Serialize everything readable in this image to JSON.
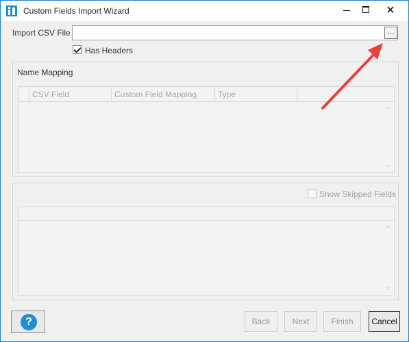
{
  "window": {
    "title": "Custom Fields Import Wizard",
    "controls": {
      "minimize": "—",
      "maximize": "☐",
      "close": "✕"
    }
  },
  "import": {
    "label": "Import CSV File",
    "value": "",
    "browse_label": "…",
    "has_headers_label": "Has Headers",
    "has_headers_checked": true
  },
  "name_mapping": {
    "title": "Name Mapping",
    "columns": [
      "",
      "CSV Field",
      "Custom Field Mapping",
      "Type",
      ""
    ]
  },
  "skipped": {
    "show_skipped_label": "Show Skipped Fields",
    "checked": false
  },
  "footer": {
    "help_label": "?",
    "back_label": "Back",
    "next_label": "Next",
    "finish_label": "Finish",
    "cancel_label": "Cancel"
  },
  "colors": {
    "accent": "#1c8fd6",
    "annotation_arrow": "#e8403a"
  },
  "scroll_icons": {
    "up": "˄",
    "down": "˅"
  }
}
